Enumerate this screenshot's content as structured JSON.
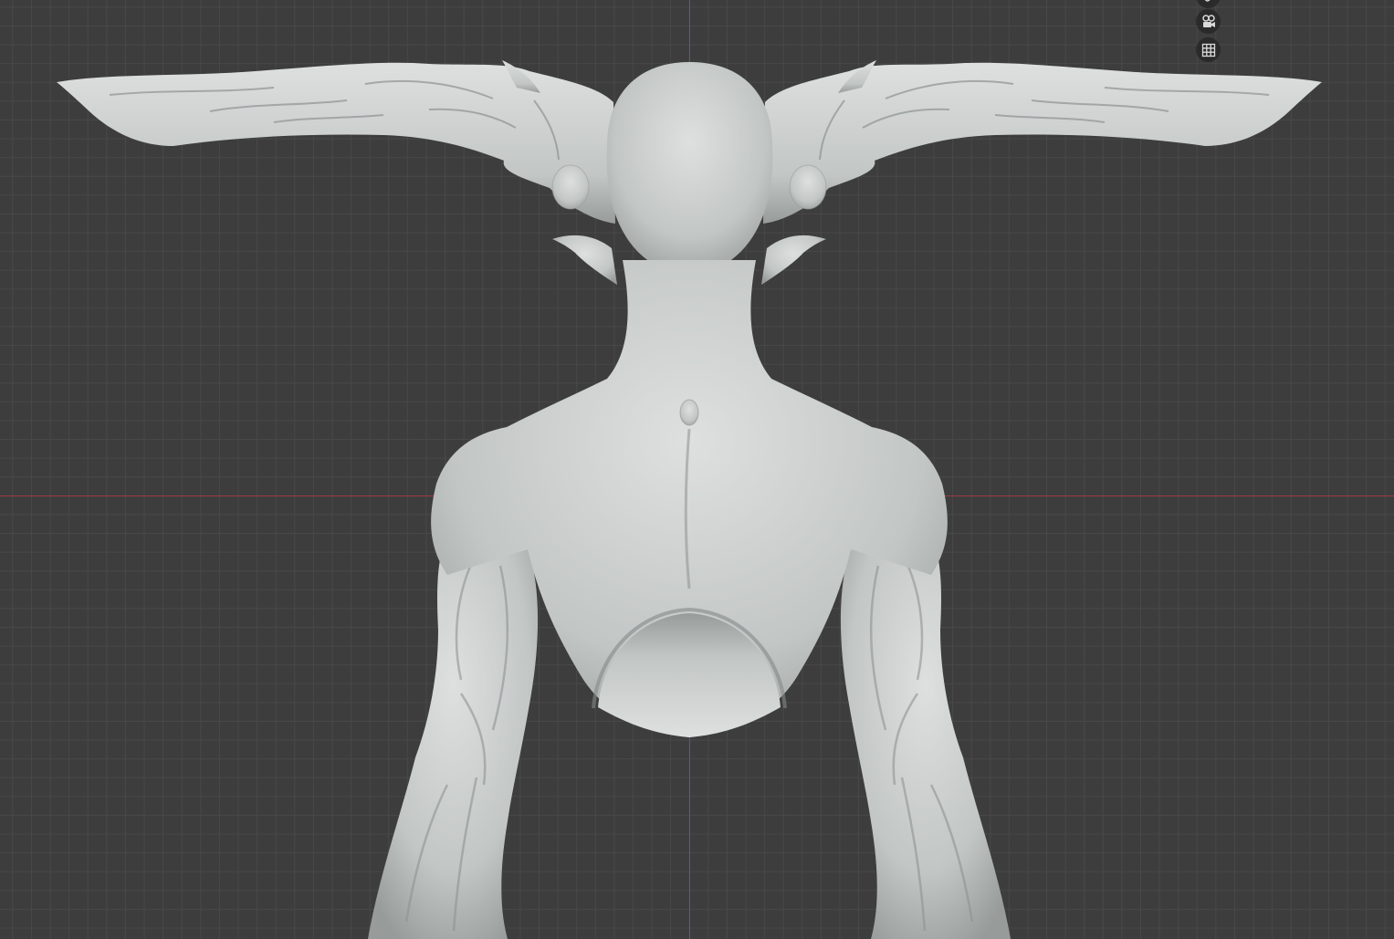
{
  "viewport": {
    "background": "#3d3d3d",
    "grid_line": "#484848",
    "x_axis": "#9a3b41",
    "z_axis": "#4a5aa8"
  },
  "navigation_gizmo": {
    "buttons": [
      {
        "icon": "hand-icon"
      },
      {
        "icon": "camera-icon"
      },
      {
        "icon": "grid-icon"
      }
    ],
    "icon_color": "#dadada"
  },
  "sculpt_model": {
    "colors": {
      "highlight": "#dde0df",
      "base": "#c2c6c5",
      "shadow": "#979c9b"
    }
  }
}
